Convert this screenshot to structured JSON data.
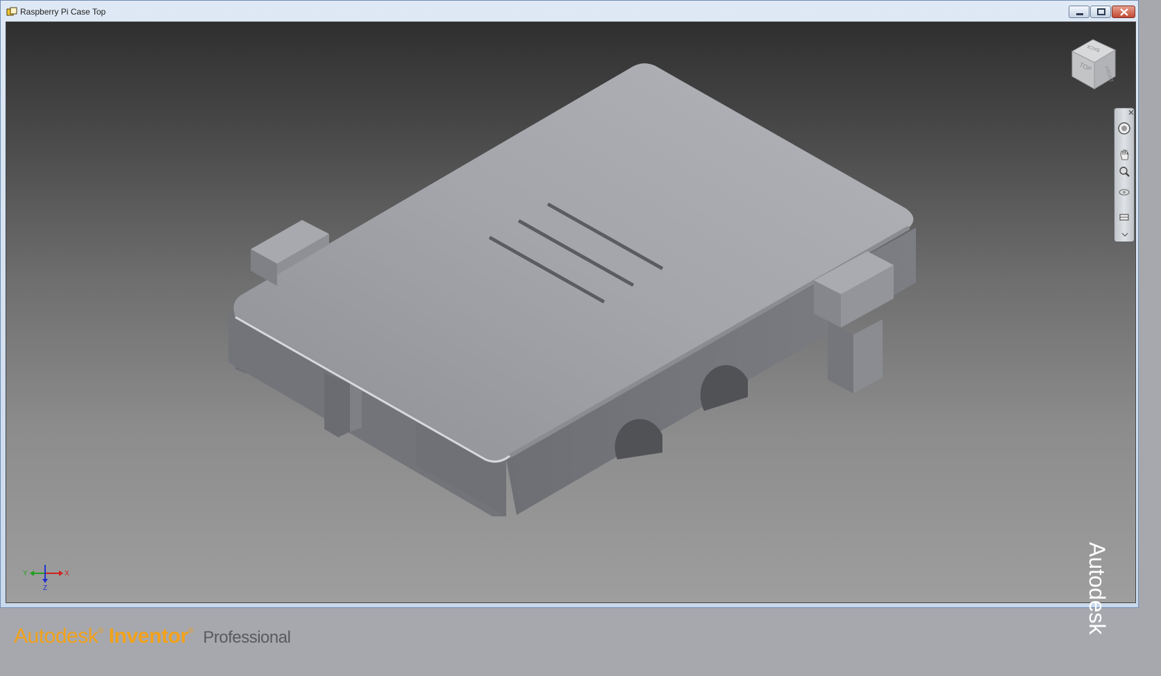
{
  "window": {
    "title": "Raspberry Pi Case Top",
    "icon": "inventor-part-icon",
    "controls": [
      "minimize",
      "restore",
      "close"
    ]
  },
  "viewcube": {
    "faces": [
      "TOP",
      "FRONT",
      "BACK"
    ]
  },
  "navbar": {
    "tools": [
      "steering-wheel-icon",
      "pan-icon",
      "zoom-icon",
      "orbit-icon",
      "look-at-icon"
    ]
  },
  "triad": {
    "x_label": "X",
    "y_label": "Y",
    "z_label": "Z",
    "colors": {
      "x": "#d22020",
      "y": "#20a020",
      "z": "#2030d0"
    }
  },
  "branding": {
    "company": "Autodesk",
    "product": "Inventor",
    "edition": "Professional",
    "vendor_mark": "Autodesk",
    "accent": "#f3a21a"
  }
}
